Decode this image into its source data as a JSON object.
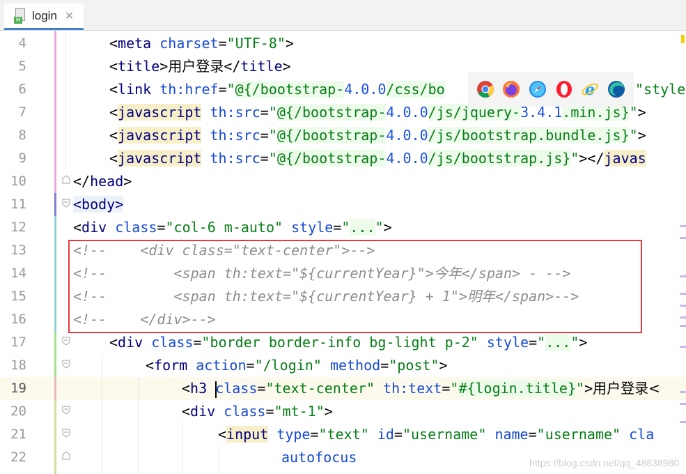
{
  "tab": {
    "label": "login",
    "file_icon": "html-file-icon",
    "badge": "H",
    "close": "✕"
  },
  "browsers": [
    "chrome-icon",
    "firefox-icon",
    "safari-icon",
    "opera-icon",
    "ie-icon",
    "edge-icon"
  ],
  "watermark": "https://blog.csdn.net/qq_48838980",
  "lines": {
    "l4": "4",
    "l5": "5",
    "l6": "6",
    "l7": "7",
    "l8": "8",
    "l9": "9",
    "l10": "10",
    "l11": "11",
    "l12": "12",
    "l13": "13",
    "l14": "14",
    "l15": "15",
    "l16": "16",
    "l17": "17",
    "l18": "18",
    "l19": "19",
    "l20": "20",
    "l21": "21",
    "l22": "22"
  },
  "code": {
    "l4": {
      "o": "<",
      "tag": "meta",
      "attr": "charset",
      "eq": "=",
      "val": "\"UTF-8\"",
      "c": ">"
    },
    "l5": {
      "o": "<",
      "tag": "title",
      "m": ">",
      "txt": "用户登录",
      "co": "</",
      "tag2": "title",
      "c": ">"
    },
    "l6": {
      "o": "<",
      "tag": "link",
      "attr": "th:href",
      "eq": "=",
      "q": "\"",
      "ex": "@{/bootstrap-",
      "n1": "4.0.0",
      "ex2": "/css/bo",
      "tail": "\"style"
    },
    "l7": {
      "o": "<",
      "tag": "javascript",
      "attr": "th:src",
      "eq": "=",
      "q": "\"",
      "ex": "@{/bootstrap-",
      "n1": "4.0.0",
      "ex2": "/js/jquery-",
      "n2": "3.4.1",
      "ex3": ".min.js}",
      "q2": "\"",
      "c": ">"
    },
    "l8": {
      "o": "<",
      "tag": "javascript",
      "attr": "th:src",
      "eq": "=",
      "q": "\"",
      "ex": "@{/bootstrap-",
      "n1": "4.0.0",
      "ex2": "/js/bootstrap.bundle.js}",
      "q2": "\"",
      "c": ">"
    },
    "l9": {
      "o": "<",
      "tag": "javascript",
      "attr": "th:src",
      "eq": "=",
      "q": "\"",
      "ex": "@{/bootstrap-",
      "n1": "4.0.0",
      "ex2": "/js/bootstrap.js}",
      "q2": "\"",
      "c": "></",
      "tag2": "javas"
    },
    "l10": {
      "o": "</",
      "tag": "head",
      "c": ">"
    },
    "l11": {
      "o": "<",
      "tag": "body",
      "c": ">"
    },
    "l12": {
      "o": "<",
      "tag": "div",
      "attr": "class",
      "eq": "=",
      "val": "\"col-6 m-auto\"",
      "attr2": "style",
      "eq2": "=",
      "q": "\"",
      "dots": "...",
      "q2": "\"",
      "c": ">"
    },
    "l13": {
      "c1": "<!--    <div class=\"text-center\">-->"
    },
    "l14": {
      "c1": "<!--        <span th:text=\"${currentYear}\">",
      "cn": "今年",
      "c2": "</span> - -->"
    },
    "l15": {
      "c1": "<!--        <span th:text=\"${currentYear} + 1\">",
      "cn": "明年",
      "c2": "</span>-->"
    },
    "l16": {
      "c1": "<!--    </div>-->"
    },
    "l17": {
      "o": "<",
      "tag": "div",
      "attr": "class",
      "eq": "=",
      "val": "\"border border-info bg-light p-2\"",
      "attr2": "style",
      "eq2": "=",
      "q": "\"",
      "dots": "...",
      "q2": "\"",
      "c": ">"
    },
    "l18": {
      "o": "<",
      "tag": "form",
      "attr": "action",
      "eq": "=",
      "val": "\"/login\"",
      "attr2": "method",
      "eq2": "=",
      "val2": "\"post\"",
      "c": ">"
    },
    "l19": {
      "o": "<",
      "tag": "h3",
      "attr": "class",
      "eq": "=",
      "val": "\"text-center\"",
      "attr2": "th:text",
      "eq2": "=",
      "q": "\"",
      "ex": "#{login.title}",
      "q2": "\"",
      "c": ">",
      "txt": "用户登录<"
    },
    "l20": {
      "o": "<",
      "tag": "div",
      "attr": "class",
      "eq": "=",
      "val": "\"mt-1\"",
      "c": ">"
    },
    "l21": {
      "o": "<",
      "tag": "input",
      "attr": "type",
      "eq": "=",
      "val": "\"text\"",
      "attr2": "id",
      "eq2": "=",
      "val2": "\"username\"",
      "attr3": "name",
      "eq3": "=",
      "val3": "\"username\"",
      "attr4": "cla"
    },
    "l22": {
      "attr": "autofocus"
    }
  }
}
